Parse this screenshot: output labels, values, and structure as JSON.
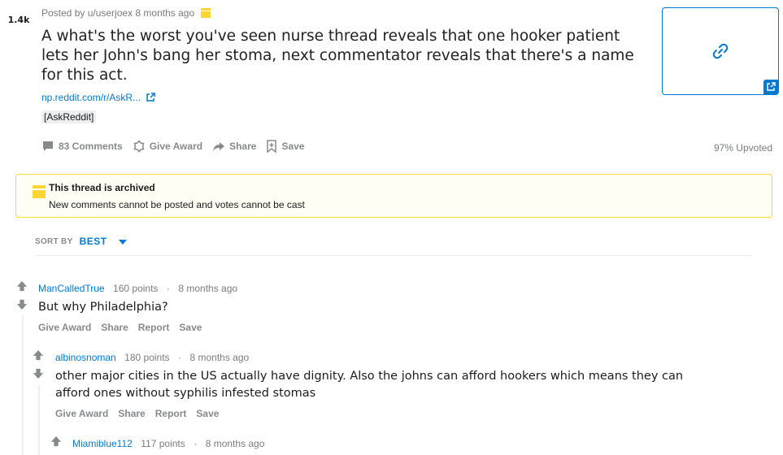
{
  "post": {
    "score": "1.4k",
    "meta": "Posted by u/userjoex 8 months ago",
    "title": "A what's the worst you've seen nurse thread reveals that one hooker patient lets her John's bang her stoma, next commentator reveals that there's a name for this act.",
    "link_text": "np.reddit.com/r/AskR...",
    "flair": "[AskReddit]",
    "actions": {
      "comments": "83 Comments",
      "award": "Give Award",
      "share": "Share",
      "save": "Save"
    },
    "upvoted": "97% Upvoted"
  },
  "archived": {
    "heading": "This thread is archived",
    "detail": "New comments cannot be posted and votes cannot be cast"
  },
  "sort": {
    "label": "SORT BY",
    "value": "BEST"
  },
  "comments": [
    {
      "user": "ManCalledTrue",
      "points": "160 points",
      "time": "8 months ago",
      "body": "But why Philadelphia?",
      "actions": [
        "Give Award",
        "Share",
        "Report",
        "Save"
      ]
    },
    {
      "user": "albinosnoman",
      "points": "180 points",
      "time": "8 months ago",
      "body": "other major cities in the US actually have dignity. Also the johns can afford hookers which means they can afford ones without syphilis infested stomas",
      "actions": [
        "Give Award",
        "Share",
        "Report",
        "Save"
      ]
    },
    {
      "user": "Miamiblue112",
      "points": "117 points",
      "time": "8 months ago"
    }
  ],
  "colors": {
    "accent": "#0079d3",
    "archive": "#ffd635",
    "muted": "#878a8c"
  }
}
